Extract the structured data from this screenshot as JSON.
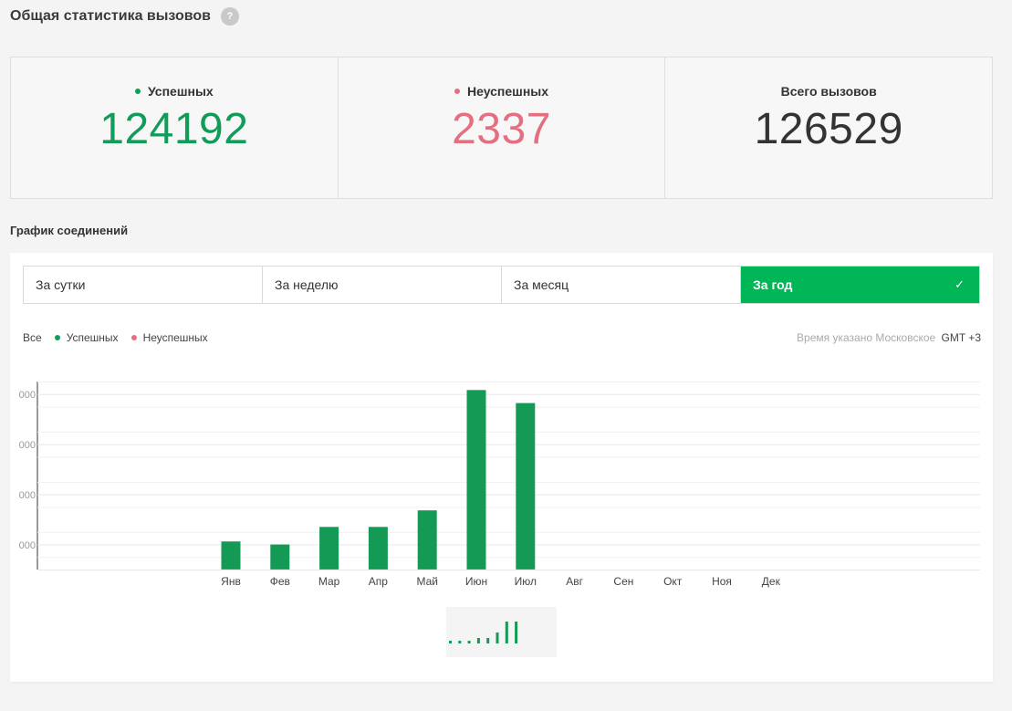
{
  "page": {
    "title": "Общая статистика вызовов",
    "help_icon_glyph": "?"
  },
  "stats": {
    "success": {
      "label": "Успешных",
      "value": "124192",
      "color": "#129c5a"
    },
    "failed": {
      "label": "Неуспешных",
      "value": "2337",
      "color": "#e36f80"
    },
    "total": {
      "label": "Всего вызовов",
      "value": "126529",
      "color": "#333333"
    }
  },
  "section": {
    "title": "График соединений"
  },
  "tabs": [
    {
      "label": "За сутки",
      "active": false
    },
    {
      "label": "За неделю",
      "active": false
    },
    {
      "label": "За месяц",
      "active": false
    },
    {
      "label": "За год",
      "active": true
    }
  ],
  "legend": {
    "all_label": "Все",
    "success_label": "Успешных",
    "failed_label": "Неуспешных"
  },
  "timezone": {
    "note": "Время указано Московское",
    "gmt": "GMT +3"
  },
  "colors": {
    "accent_green": "#00b656",
    "bar_green": "#159a56",
    "failed_pink": "#e36f80"
  },
  "icons": {
    "help": "help-icon",
    "check": "check-icon"
  },
  "chart_data": {
    "type": "bar",
    "categories": [
      "Янв",
      "Фев",
      "Мар",
      "Апр",
      "Май",
      "Июн",
      "Июл",
      "Авг",
      "Сен",
      "Окт",
      "Ноя",
      "Дек"
    ],
    "series": [
      {
        "name": "Успешных",
        "values": [
          5600,
          5000,
          8500,
          8500,
          11800,
          35800,
          33200,
          0,
          0,
          0,
          0,
          0
        ]
      },
      {
        "name": "Неуспешных",
        "values": [
          100,
          90,
          180,
          170,
          250,
          790,
          750,
          0,
          0,
          0,
          0,
          0
        ]
      }
    ],
    "ylim": [
      0,
      37500
    ],
    "yticks": [
      5000,
      15000,
      25000,
      35000
    ],
    "ytick_labels": [
      "000",
      "000",
      "000",
      "000"
    ],
    "grid": true,
    "mini_chart_values": [
      1,
      1,
      1,
      2,
      2,
      4,
      8,
      8
    ]
  }
}
